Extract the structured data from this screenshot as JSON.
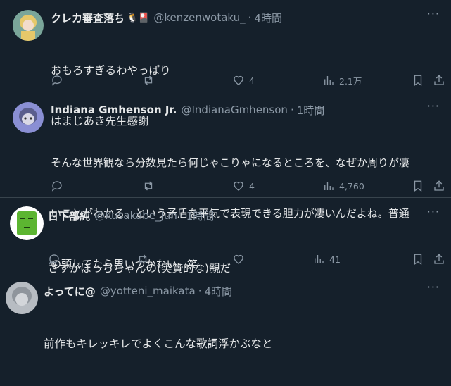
{
  "tweets": [
    {
      "name": "クレカ審査落ち",
      "emoji": "🐧🎴",
      "handle": "@kenzenwotaku_",
      "time": "4時間",
      "lines": [
        "おもろすぎるわやっぱり",
        "はまじあき先生感謝"
      ],
      "replies": "",
      "retweets": "",
      "likes": "4",
      "views": "2.1万",
      "avatar_colors": {
        "bg": "#7aa69a",
        "hair": "#e6c86a",
        "face": "#f3dccb"
      }
    },
    {
      "name": "Indiana Gmhenson Jr.",
      "emoji": "",
      "handle": "@IndianaGmhenson",
      "time": "1時間",
      "lines": [
        "そんな世界観なら分数見たら何じゃこりゃになるところを、なぜか周りが凄",
        "いことがわかる、という矛盾を平気で表現できる胆力が凄いんだよね。普通",
        "の頭してたら思いつかない...笑"
      ],
      "replies": "",
      "retweets": "",
      "likes": "4",
      "views": "4,760",
      "avatar_colors": {
        "bg": "#8a8fd4",
        "hair": "#5a5e8c",
        "face": "#d9d9e6"
      }
    },
    {
      "name": "日下部純",
      "emoji": "",
      "handle": "@Kusakabe_Jun",
      "time": "1時間",
      "lines": [
        "さすがぼっちちゃんの(実質的な)親だ"
      ],
      "replies": "",
      "retweets": "",
      "likes": "",
      "views": "41",
      "avatar_colors": {
        "bg": "#ffffff",
        "hair": "#5cb531",
        "face": "#5cb531"
      }
    },
    {
      "name": "よってに@",
      "emoji": "",
      "handle": "@yotteni_maikata",
      "time": "4時間",
      "lines": [
        "前作もキレッキレでよくこんな歌詞浮かぶなと"
      ],
      "replies": "",
      "retweets": "",
      "likes": "",
      "views": "",
      "avatar_colors": {
        "bg": "#b7bcc2",
        "hair": "#8f959c",
        "face": "#d3d6da"
      }
    }
  ],
  "more_label": "···"
}
